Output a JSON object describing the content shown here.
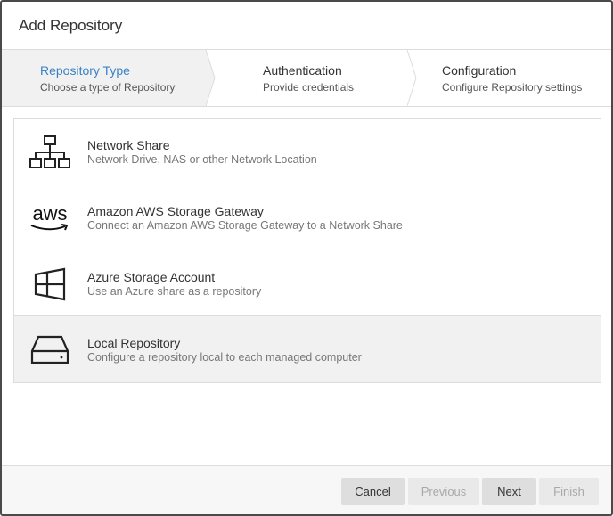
{
  "dialog": {
    "title": "Add Repository"
  },
  "steps": [
    {
      "title": "Repository Type",
      "subtitle": "Choose a type of Repository",
      "active": true
    },
    {
      "title": "Authentication",
      "subtitle": "Provide credentials",
      "active": false
    },
    {
      "title": "Configuration",
      "subtitle": "Configure Repository settings",
      "active": false
    }
  ],
  "repository_types": [
    {
      "icon": "network-share-icon",
      "title": "Network Share",
      "description": "Network Drive, NAS or other Network Location",
      "selected": false
    },
    {
      "icon": "aws-logo-icon",
      "icon_text": "aws",
      "title": "Amazon AWS Storage Gateway",
      "description": "Connect an Amazon AWS Storage Gateway to a Network Share",
      "selected": false
    },
    {
      "icon": "windows-logo-icon",
      "title": "Azure Storage Account",
      "description": "Use an Azure share as a repository",
      "selected": false
    },
    {
      "icon": "hard-drive-icon",
      "title": "Local Repository",
      "description": "Configure a repository local to each managed computer",
      "selected": true
    }
  ],
  "footer": {
    "cancel_label": "Cancel",
    "previous_label": "Previous",
    "next_label": "Next",
    "finish_label": "Finish"
  },
  "colors": {
    "active_step": "#3c82c4",
    "selected_row": "#f1f1f1",
    "border": "#dcdcdc"
  }
}
